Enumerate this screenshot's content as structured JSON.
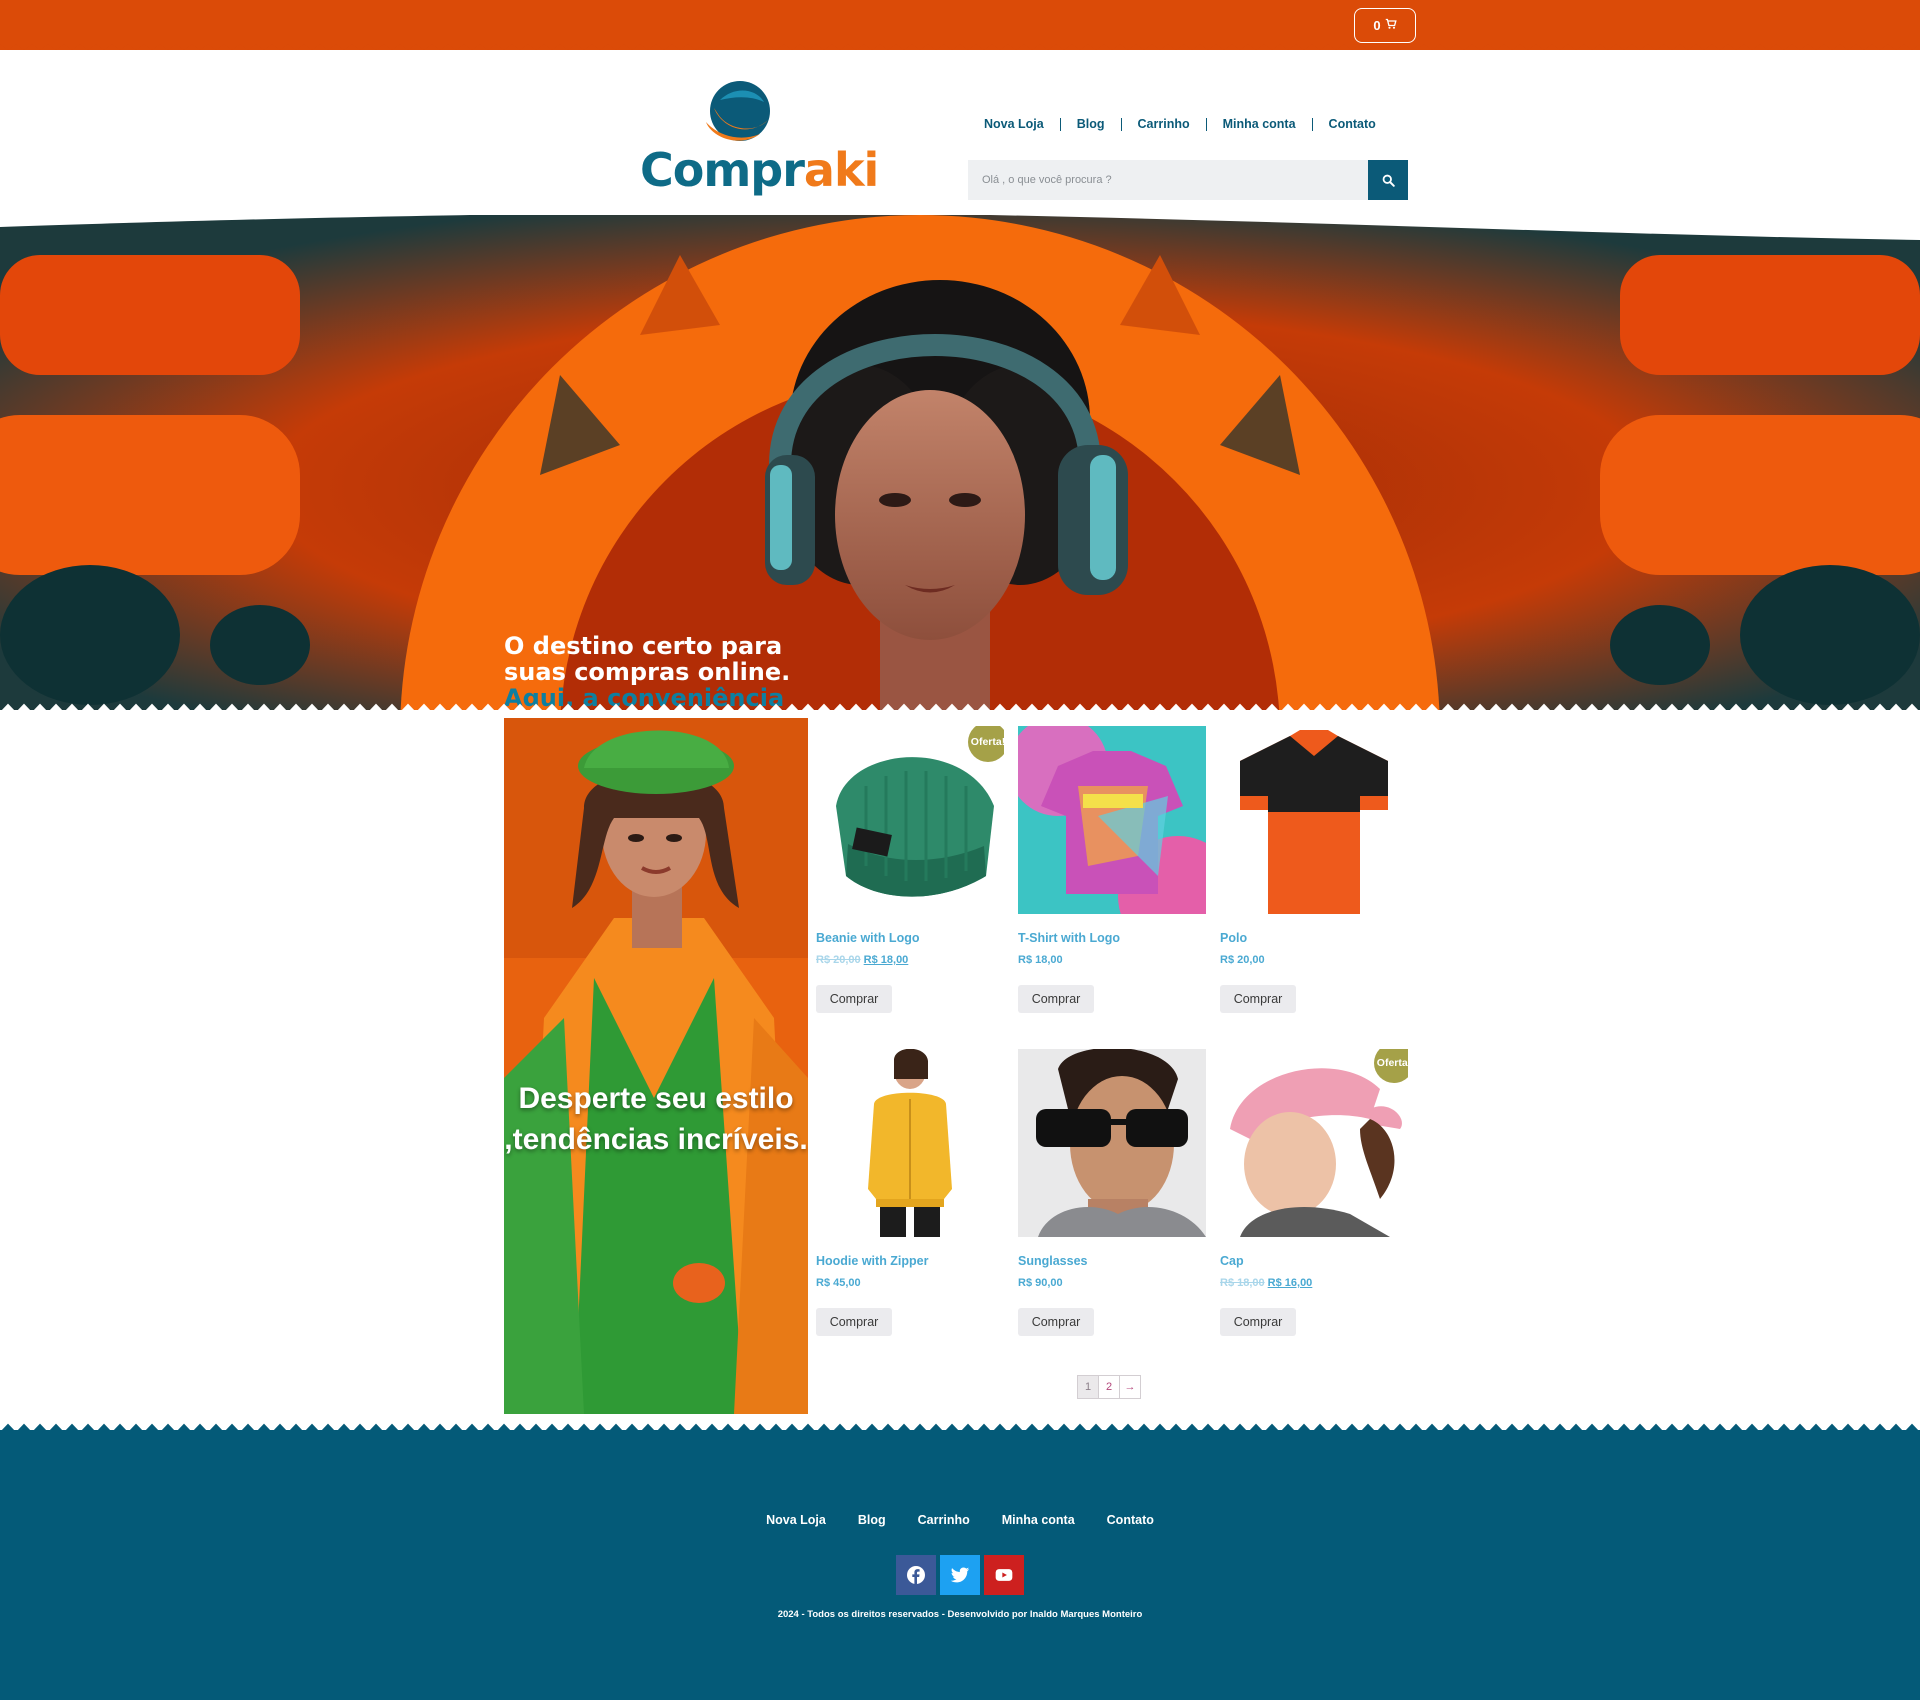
{
  "topbar": {
    "cart_count": "0",
    "cart_icon": "cart-icon"
  },
  "header": {
    "logo": {
      "part1": "Compr",
      "part2": "aki"
    },
    "nav": [
      "Nova Loja",
      "Blog",
      "Carrinho",
      "Minha conta",
      "Contato"
    ],
    "search": {
      "placeholder": "Olá , o que você procura ?",
      "icon": "search-icon"
    }
  },
  "hero": {
    "line_white": "O destino certo para suas compras online.",
    "line_teal": "Aqui, a conveniência está apenas a um clique de distância"
  },
  "promo": {
    "text": "Desperte seu estilo ,tendências incríveis."
  },
  "products": [
    {
      "name": "Beanie with Logo",
      "old_price": "R$ 20,00",
      "price": "R$ 18,00",
      "badge": "Oferta!",
      "button": "Comprar"
    },
    {
      "name": "T-Shirt with Logo",
      "old_price": "",
      "price": "R$ 18,00",
      "badge": "",
      "button": "Comprar"
    },
    {
      "name": "Polo",
      "old_price": "",
      "price": "R$ 20,00",
      "badge": "",
      "button": "Comprar"
    },
    {
      "name": "Hoodie with Zipper",
      "old_price": "",
      "price": "R$ 45,00",
      "badge": "",
      "button": "Comprar"
    },
    {
      "name": "Sunglasses",
      "old_price": "",
      "price": "R$ 90,00",
      "badge": "",
      "button": "Comprar"
    },
    {
      "name": "Cap",
      "old_price": "R$ 18,00",
      "price": "R$ 16,00",
      "badge": "Oferta!",
      "button": "Comprar"
    }
  ],
  "pagination": {
    "pages": [
      "1",
      "2"
    ],
    "next": "→",
    "current": "1"
  },
  "footer": {
    "nav": [
      "Nova Loja",
      "Blog",
      "Carrinho",
      "Minha conta",
      "Contato"
    ],
    "socials": [
      "facebook-icon",
      "twitter-icon",
      "youtube-icon"
    ],
    "copyright": "2024 - Todos os direitos reservados - Desenvolvido por Inaldo Marques Monteiro"
  },
  "colors": {
    "brand_orange": "#db4b08",
    "brand_teal": "#045a78",
    "link_blue": "#4aa9d2",
    "badge": "#a5a148"
  }
}
